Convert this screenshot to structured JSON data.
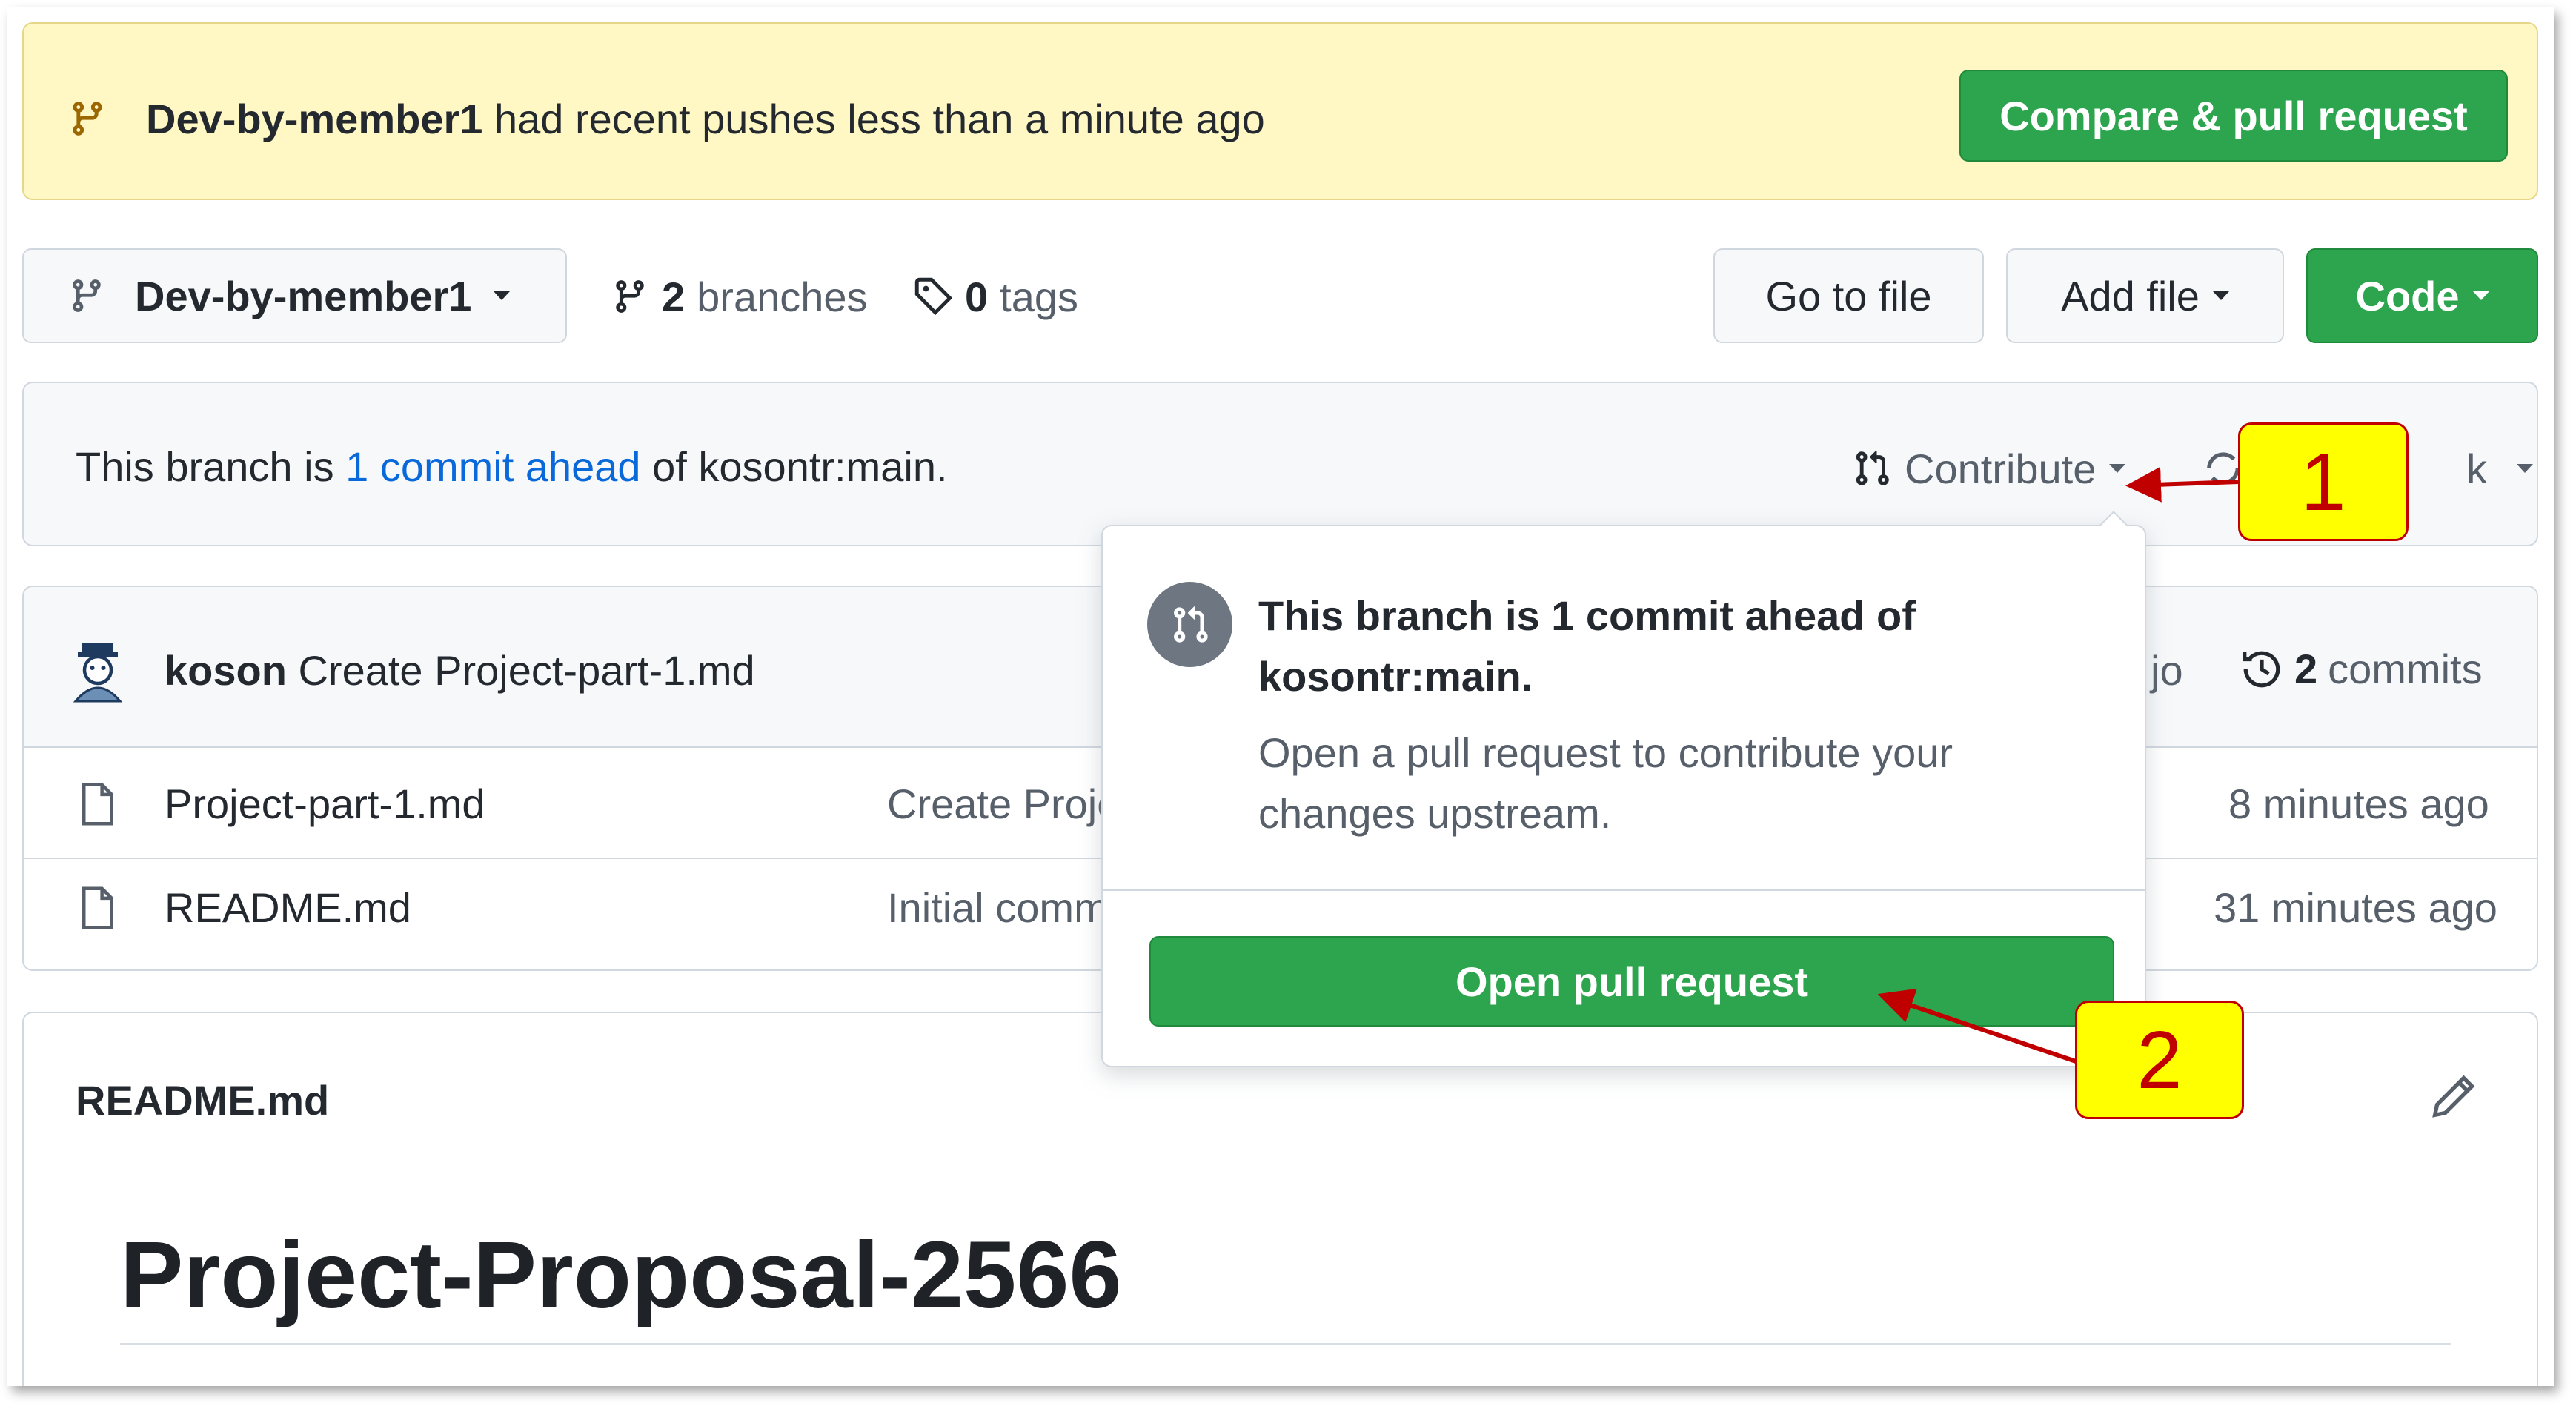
{
  "banner": {
    "branch": "Dev-by-member1",
    "message": "had recent pushes less than a minute ago",
    "compare_button": "Compare & pull request"
  },
  "toolbar": {
    "branch_selector": "Dev-by-member1",
    "branches_count": "2",
    "branches_label": "branches",
    "tags_count": "0",
    "tags_label": "tags",
    "go_to_file": "Go to file",
    "add_file": "Add file",
    "code": "Code"
  },
  "ahead_bar": {
    "prefix": "This branch is",
    "link": "1 commit ahead",
    "suffix": "of kosontr:main.",
    "contribute": "Contribute",
    "sync_partial": "k"
  },
  "commit_header": {
    "author": "koson",
    "message": "Create Project-part-1.md",
    "time_partial": "jo",
    "commits_count": "2",
    "commits_label": "commits"
  },
  "files": [
    {
      "name": "Project-part-1.md",
      "commit": "Create Proje",
      "time": "8 minutes ago"
    },
    {
      "name": "README.md",
      "commit": "Initial comm",
      "time": "31 minutes ago"
    }
  ],
  "readme": {
    "filename": "README.md",
    "heading": "Project-Proposal-2566"
  },
  "popover": {
    "title_line1": "This branch is 1 commit ahead of",
    "title_line2": "kosontr:main.",
    "desc_line1": "Open a pull request to contribute your",
    "desc_line2": "changes upstream.",
    "open_pr": "Open pull request"
  },
  "annotations": {
    "label1": "1",
    "label2": "2",
    "color": "#c00000"
  },
  "colors": {
    "green": "#2da44e",
    "banner_bg": "#fff8c5",
    "link": "#0969da"
  }
}
